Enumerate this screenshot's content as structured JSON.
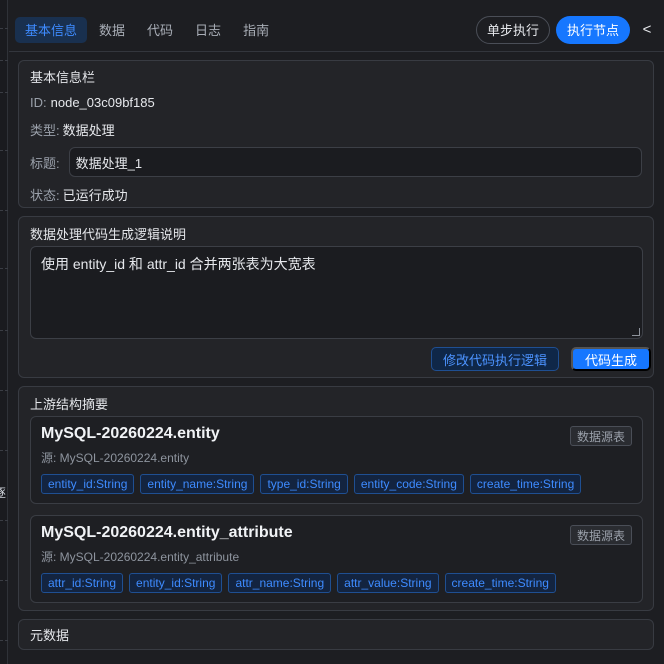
{
  "edge": {
    "glyph": "逐"
  },
  "tabs": [
    {
      "label": "基本信息",
      "active": true
    },
    {
      "label": "数据",
      "active": false
    },
    {
      "label": "代码",
      "active": false
    },
    {
      "label": "日志",
      "active": false
    },
    {
      "label": "指南",
      "active": false
    }
  ],
  "actions": {
    "step_run": "单步执行",
    "run_node": "执行节点",
    "collapse": "<"
  },
  "basic": {
    "title": "基本信息栏",
    "id_label": "ID:",
    "id_value": "node_03c09bf185",
    "type_label": "类型:",
    "type_value": "数据处理",
    "name_label": "标题:",
    "name_value": "数据处理_1",
    "status_label": "状态:",
    "status_value": "已运行成功"
  },
  "logic": {
    "title": "数据处理代码生成逻辑说明",
    "text": "使用 entity_id 和 attr_id 合并两张表为大宽表",
    "modify_button": "修改代码执行逻辑",
    "generate_button": "代码生成"
  },
  "upstream": {
    "title": "上游结构摘要",
    "cards": [
      {
        "name": "MySQL-20260224.entity",
        "source": "源: MySQL-20260224.entity",
        "badge": "数据源表",
        "fields": [
          "entity_id:String",
          "entity_name:String",
          "type_id:String",
          "entity_code:String",
          "create_time:String"
        ]
      },
      {
        "name": "MySQL-20260224.entity_attribute",
        "source": "源: MySQL-20260224.entity_attribute",
        "badge": "数据源表",
        "fields": [
          "attr_id:String",
          "entity_id:String",
          "attr_name:String",
          "attr_value:String",
          "create_time:String"
        ]
      }
    ]
  },
  "meta": {
    "title": "元数据"
  },
  "colors": {
    "accent": "#1677ff",
    "accent_text": "#3e8bff",
    "background": "#1d1e22",
    "panel": "#232428"
  }
}
